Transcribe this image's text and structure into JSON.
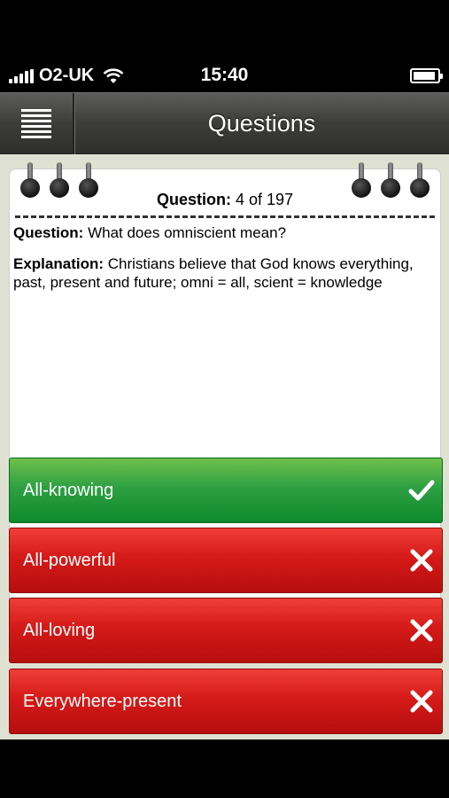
{
  "status": {
    "carrier": "O2-UK",
    "time": "15:40"
  },
  "navbar": {
    "title": "Questions",
    "menu_icon": "hamburger-menu-icon"
  },
  "card": {
    "header_label": "Question:",
    "header_value": "4 of 197",
    "question_label": "Question:",
    "question_text": "What does omniscient mean?",
    "explanation_label": "Explanation:",
    "explanation_text": "Christians believe that God knows everything, past, present and future; omni = all, scient = knowledge"
  },
  "answers": [
    {
      "label": "All-knowing",
      "state": "correct",
      "icon": "check-icon",
      "color": "#2ea043"
    },
    {
      "label": "All-powerful",
      "state": "wrong",
      "icon": "cross-icon",
      "color": "#d51a18"
    },
    {
      "label": "All-loving",
      "state": "wrong",
      "icon": "cross-icon",
      "color": "#d51a18"
    },
    {
      "label": "Everywhere-present",
      "state": "wrong",
      "icon": "cross-icon",
      "color": "#d51a18"
    }
  ]
}
